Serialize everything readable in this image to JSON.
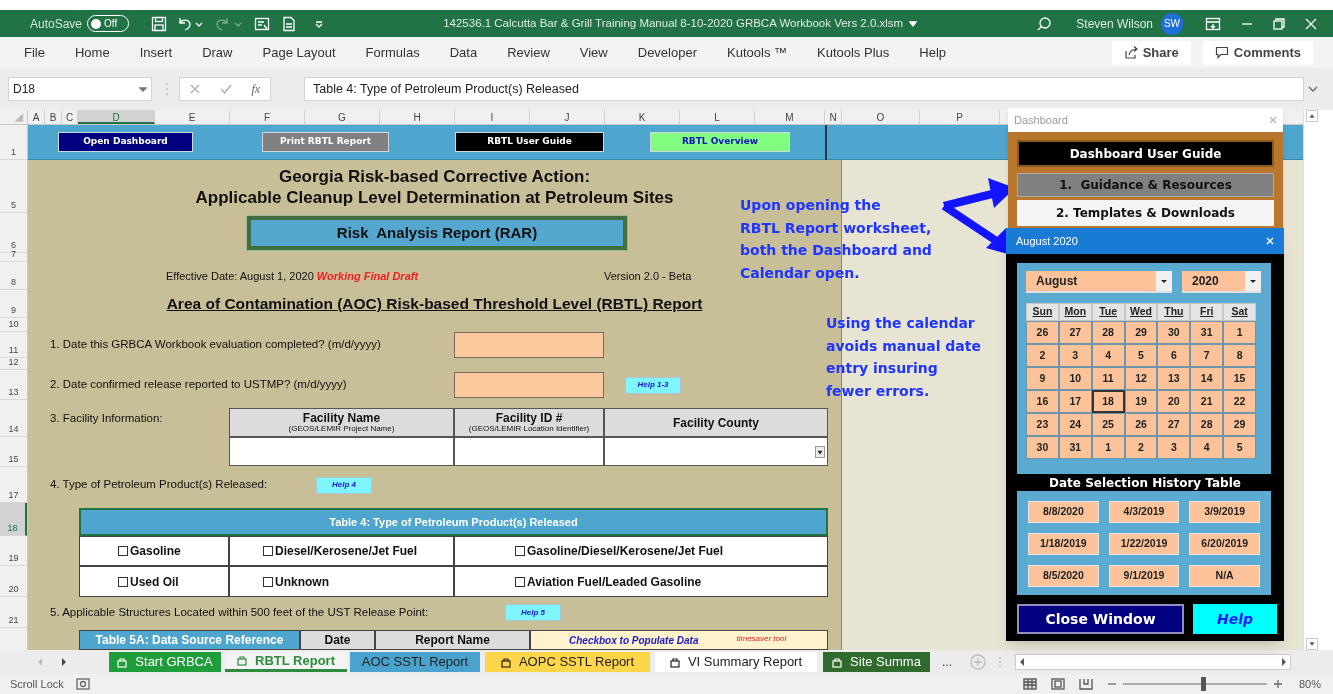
{
  "title_bar": {
    "autosave": {
      "label": "AutoSave",
      "state_text": "Off",
      "on": false
    },
    "document_title": "142536.1 Calcutta Bar & Grill Training Manual 8-10-2020 GRBCA Workbook Vers 2.0.xlsm",
    "user_name": "Steven Wilson",
    "user_initials": "SW"
  },
  "ribbon_tabs": [
    "File",
    "Home",
    "Insert",
    "Draw",
    "Page Layout",
    "Formulas",
    "Data",
    "Review",
    "View",
    "Developer",
    "Kutools ™",
    "Kutools Plus",
    "Help"
  ],
  "ribbon_buttons": [
    {
      "kind": "share",
      "label": "Share"
    },
    {
      "kind": "comments",
      "label": "Comments"
    }
  ],
  "formula_bar": {
    "name_box": "D18",
    "function_label": "fx",
    "formula": "Table 4: Type of Petroleum Product(s) Released"
  },
  "column_headers": [
    {
      "label": "A",
      "selected": false
    },
    {
      "label": "B",
      "selected": false
    },
    {
      "label": "C",
      "selected": false
    },
    {
      "label": "D",
      "selected": true
    },
    {
      "label": "E",
      "selected": false
    },
    {
      "label": "F",
      "selected": false
    },
    {
      "label": "G",
      "selected": false
    },
    {
      "label": "H",
      "selected": false
    },
    {
      "label": "I",
      "selected": false
    },
    {
      "label": "J",
      "selected": false
    },
    {
      "label": "K",
      "selected": false
    },
    {
      "label": "L",
      "selected": false
    },
    {
      "label": "M",
      "selected": false
    },
    {
      "label": "N",
      "selected": false
    },
    {
      "label": "O",
      "selected": false
    },
    {
      "label": "P",
      "selected": false
    }
  ],
  "row_headers": [
    {
      "label": "1",
      "selected": false
    },
    {
      "label": "5",
      "selected": false
    },
    {
      "label": "6",
      "selected": false
    },
    {
      "label": "7",
      "selected": false
    },
    {
      "label": "8",
      "selected": false
    },
    {
      "label": "9",
      "selected": false
    },
    {
      "label": "10",
      "selected": false
    },
    {
      "label": "11",
      "selected": false
    },
    {
      "label": "12",
      "selected": false
    },
    {
      "label": "13",
      "selected": false
    },
    {
      "label": "14",
      "selected": false
    },
    {
      "label": "15",
      "selected": false
    },
    {
      "label": "17",
      "selected": false
    },
    {
      "label": "18",
      "selected": true
    },
    {
      "label": "19",
      "selected": false
    },
    {
      "label": "20",
      "selected": false
    },
    {
      "label": "21",
      "selected": false
    }
  ],
  "sheet_buttons": [
    {
      "label": "Open Dashboard",
      "color": "#000080"
    },
    {
      "label": "Print RBTL Report",
      "color": "#808080"
    },
    {
      "label": "RBTL User Guide",
      "color": "#000000"
    },
    {
      "label": "RBTL Overview",
      "color": "#80ff80"
    }
  ],
  "heading": [
    "Georgia Risk-based Corrective Action:",
    "Applicable Cleanup Level Determination at Petroleum Sites"
  ],
  "report_box": "Risk  Analysis Report (RAR)",
  "effective_date": "Effective Date: August 1, 2020",
  "draft_note": "Working Final Draft",
  "version": "Version 2.0 - Beta",
  "report_title": "Area of Contamination (AOC) Risk-based Threshold Level (RBTL) Report",
  "question_1": {
    "text": "1. Date this GRBCA Workbook evaluation completed? (m/d/yyyy)"
  },
  "question_2": {
    "text": "2. Date confirmed release reported to USTMP? (m/d/yyyy)",
    "help": "Help 1-3"
  },
  "facility_table": {
    "label": "3. Facility Information:",
    "columns": [
      {
        "title": "Facility Name",
        "subtitle": "(GEOS/LEMIR Project Name)"
      },
      {
        "title": "Facility ID #",
        "subtitle": "(GEOS/LEMIR Location Identifier)"
      },
      {
        "title": "Facility County"
      }
    ]
  },
  "question_4": {
    "text": "4. Type of Petroleum Product(s) Released:",
    "help": "Help 4"
  },
  "table_4": {
    "title": "Table 4: Type of Petroleum Product(s) Released",
    "options": [
      {
        "label": "Gasoline",
        "checked": false
      },
      {
        "label": "Diesel/Kerosene/Jet Fuel",
        "checked": false
      },
      {
        "label": "Gasoline/Diesel/Kerosene/Jet Fuel",
        "checked": false
      },
      {
        "label": "Used Oil",
        "checked": false
      },
      {
        "label": "Unknown",
        "checked": false
      },
      {
        "label": "Aviation Fuel/Leaded Gasoline",
        "checked": false
      }
    ]
  },
  "question_5": {
    "text": "5. Applicable Structures Located within 500 feet of the UST Release Point:",
    "help": "Help 5"
  },
  "table_5a": {
    "title": "Table 5A: Data Source Reference",
    "date_header": "Date",
    "report_name_header": "Report Name",
    "note": "Checkbox to Populate Data",
    "note_tag": "timesaver tool"
  },
  "annotations": [
    {
      "lines": [
        "Upon opening the",
        "RBTL Report worksheet,",
        "both the Dashboard and",
        "Calendar open."
      ]
    },
    {
      "lines": [
        "Using the calendar",
        "avoids manual date",
        "entry insuring",
        "fewer errors."
      ]
    }
  ],
  "dashboard": {
    "title": "Dashboard",
    "buttons": [
      {
        "kind": "dark",
        "label": "Dashboard User Guide"
      },
      {
        "kind": "grey",
        "label": "1.  Guidance & Resources"
      },
      {
        "kind": "light",
        "label": "2. Templates & Downloads"
      }
    ]
  },
  "calendar": {
    "title": "August 2020",
    "month": "August",
    "year": "2020",
    "weekdays": [
      "Sun",
      "Mon",
      "Tue",
      "Wed",
      "Thu",
      "Fri",
      "Sat"
    ],
    "weeks": [
      [
        {
          "day": "26",
          "selected": false
        },
        {
          "day": "27",
          "selected": false
        },
        {
          "day": "28",
          "selected": false
        },
        {
          "day": "29",
          "selected": false
        },
        {
          "day": "30",
          "selected": false
        },
        {
          "day": "31",
          "selected": false
        },
        {
          "day": "1",
          "selected": false
        }
      ],
      [
        {
          "day": "2",
          "selected": false
        },
        {
          "day": "3",
          "selected": false
        },
        {
          "day": "4",
          "selected": false
        },
        {
          "day": "5",
          "selected": false
        },
        {
          "day": "6",
          "selected": false
        },
        {
          "day": "7",
          "selected": false
        },
        {
          "day": "8",
          "selected": false
        }
      ],
      [
        {
          "day": "9",
          "selected": false
        },
        {
          "day": "10",
          "selected": false
        },
        {
          "day": "11",
          "selected": false
        },
        {
          "day": "12",
          "selected": false
        },
        {
          "day": "13",
          "selected": false
        },
        {
          "day": "14",
          "selected": false
        },
        {
          "day": "15",
          "selected": false
        }
      ],
      [
        {
          "day": "16",
          "selected": false
        },
        {
          "day": "17",
          "selected": false
        },
        {
          "day": "18",
          "selected": true
        },
        {
          "day": "19",
          "selected": false
        },
        {
          "day": "20",
          "selected": false
        },
        {
          "day": "21",
          "selected": false
        },
        {
          "day": "22",
          "selected": false
        }
      ],
      [
        {
          "day": "23",
          "selected": false
        },
        {
          "day": "24",
          "selected": false
        },
        {
          "day": "25",
          "selected": false
        },
        {
          "day": "26",
          "selected": false
        },
        {
          "day": "27",
          "selected": false
        },
        {
          "day": "28",
          "selected": false
        },
        {
          "day": "29",
          "selected": false
        }
      ],
      [
        {
          "day": "30",
          "selected": false
        },
        {
          "day": "31",
          "selected": false
        },
        {
          "day": "1",
          "selected": false
        },
        {
          "day": "2",
          "selected": false
        },
        {
          "day": "3",
          "selected": false
        },
        {
          "day": "4",
          "selected": false
        },
        {
          "day": "5",
          "selected": false
        }
      ]
    ],
    "history_title": "Date Selection History Table",
    "history": [
      "8/8/2020",
      "4/3/2019",
      "3/9/2019",
      "1/18/2019",
      "1/22/2019",
      "6/20/2019",
      "8/5/2020",
      "9/1/2019",
      "N/A"
    ],
    "buttons": [
      {
        "kind": "close",
        "label": "Close Window"
      },
      {
        "kind": "help",
        "label": "Help"
      }
    ]
  },
  "sheet_tabs": [
    {
      "label": "Start GRBCA",
      "color": "#1f9d3a",
      "selected": false,
      "protected": true
    },
    {
      "label": "RBTL Report",
      "color": "#2e8b3e",
      "selected": true,
      "protected": true
    },
    {
      "label": "AOC SSTL Report",
      "color": "#4aa3cc",
      "selected": false,
      "protected": false
    },
    {
      "label": "AOPC SSTL Report",
      "color": "#ffd54a",
      "selected": false,
      "protected": true
    },
    {
      "label": "VI Summary Report",
      "color": "#ffffff",
      "selected": false,
      "protected": true
    },
    {
      "label": "Site Summa",
      "color": "#2f6b2c",
      "selected": false,
      "protected": true
    }
  ],
  "tab_overflow": "...",
  "status_bar": {
    "mode": "Scroll Lock",
    "zoom_slider": {
      "level": 0.56
    },
    "zoom": "80%"
  }
}
